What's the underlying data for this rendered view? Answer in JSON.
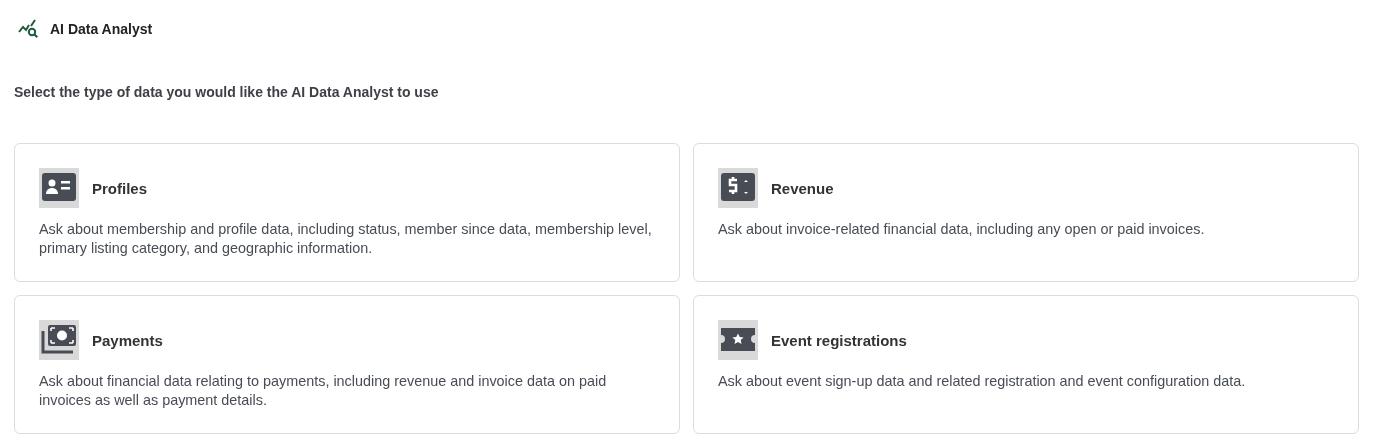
{
  "header": {
    "title": "AI Data Analyst"
  },
  "prompt": "Select the type of data you would like the AI Data Analyst to use",
  "cards": [
    {
      "kind": "profiles",
      "title": "Profiles",
      "description": "Ask about membership and profile data, including status, member since data, membership level, primary listing category, and geographic information."
    },
    {
      "kind": "revenue",
      "title": "Revenue",
      "description": "Ask about invoice-related financial data, including any open or paid invoices."
    },
    {
      "kind": "payments",
      "title": "Payments",
      "description": "Ask about financial data relating to payments, including revenue and invoice data on paid invoices as well as payment details."
    },
    {
      "kind": "events",
      "title": "Event registrations",
      "description": "Ask about event sign-up data and related registration and event configuration data."
    }
  ]
}
